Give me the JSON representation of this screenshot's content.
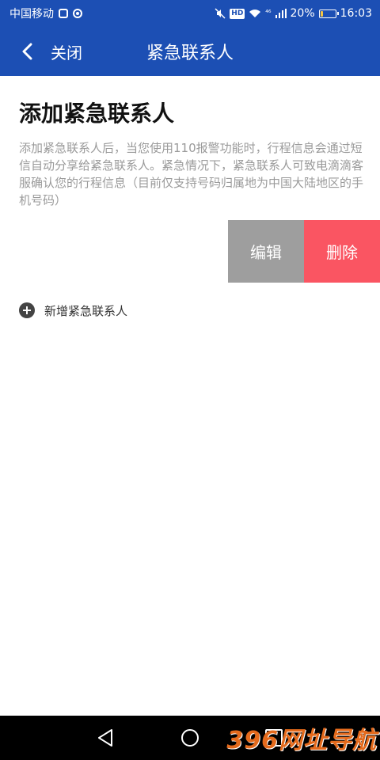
{
  "status_bar": {
    "carrier": "中国移动",
    "hd_label": "HD",
    "network": "⁴⁶",
    "battery": "20%",
    "battery_level": 0.2,
    "time": "16:03"
  },
  "app_bar": {
    "close_label": "关闭",
    "title": "紧急联系人"
  },
  "main": {
    "title": "添加紧急联系人",
    "description": "添加紧急联系人后，当您使用110报警功能时，行程信息会通过短信自动分享给紧急联系人。紧急情况下，紧急联系人可致电滴滴客服确认您的行程信息（目前仅支持号码归属地为中国大陆地区的手机号码）",
    "edit_label": "编辑",
    "delete_label": "删除",
    "add_contact_label": "新增紧急联系人"
  },
  "watermark": "396网址导航",
  "colors": {
    "primary": "#1c4fb4",
    "edit_bg": "#9e9e9e",
    "delete_bg": "#fa5562",
    "description_text": "#9a9a9a"
  },
  "icons": {
    "back": "chevron-left-icon",
    "add": "plus-circle-icon",
    "nav_back": "triangle-back-icon",
    "nav_home": "circle-home-icon",
    "nav_recent": "square-recent-icon"
  }
}
